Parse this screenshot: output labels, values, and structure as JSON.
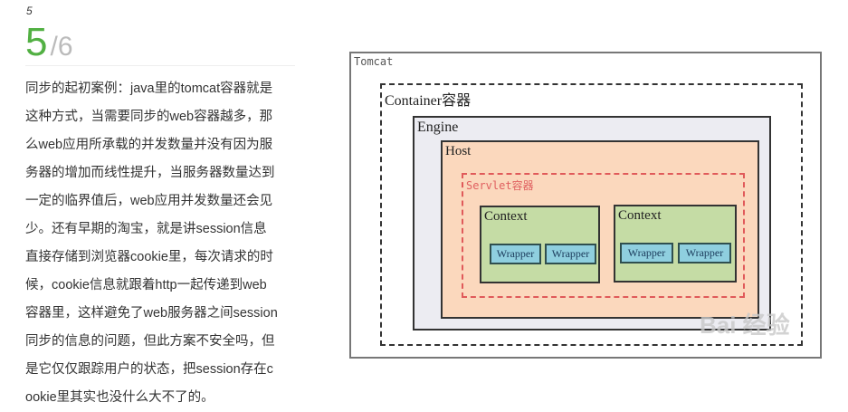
{
  "step": {
    "small": "5",
    "current": "5",
    "total": "/6"
  },
  "body_lines": [
    "同步的起初案例：java里的tomcat容器就是",
    "这种方式，当需要同步的web容器越多，那",
    "么web应用所承载的并发数量并没有因为服",
    "务器的增加而线性提升，当服务器数量达到",
    "一定的临界值后，web应用并发数量还会见",
    "少。还有早期的淘宝，就是讲session信息",
    "直接存储到浏览器cookie里，每次请求的时",
    "候，cookie信息就跟着http一起传递到web",
    "容器里，这样避免了web服务器之间session",
    "同步的信息的问题，但此方案不安全吗，但",
    "是它仅仅跟踪用户的状态，把session存在c",
    "ookie里其实也没什么大不了的。"
  ],
  "diagram": {
    "tomcat": "Tomcat",
    "container": "Container容器",
    "engine": "Engine",
    "host": "Host",
    "servlet": "Servlet容器",
    "contexts": [
      {
        "label": "Context",
        "wrappers": [
          "Wrapper",
          "Wrapper"
        ]
      },
      {
        "label": "Context",
        "wrappers": [
          "Wrapper",
          "Wrapper"
        ]
      }
    ],
    "watermark": "Bai 经验"
  },
  "colors": {
    "accent": "#52b043",
    "host": "#fbd8bd",
    "engine": "#ececf2",
    "context": "#c5dca5",
    "wrapper": "#8fcfdf",
    "servlet_border": "#e05a5a"
  }
}
